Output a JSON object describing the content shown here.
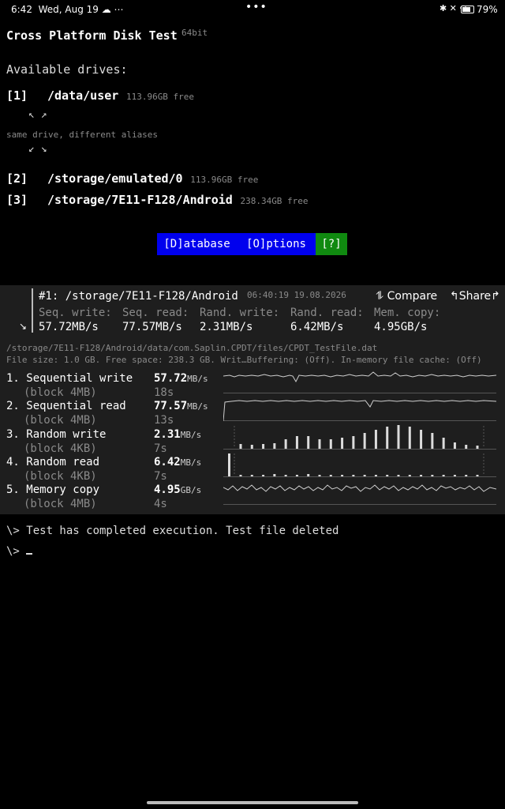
{
  "status_bar": {
    "time": "6:42",
    "date": "Wed, Aug 19",
    "left_icons": "☁ ⋯",
    "center_dots": "•••",
    "right_icons": "✱ ✕ ◠",
    "battery_percent": "79%",
    "battery_level": 0.79
  },
  "header": {
    "title": "Cross Platform Disk Test",
    "bits": "64bit"
  },
  "drives_heading": "Available drives:",
  "drives": [
    {
      "index": "[1]",
      "path": "/data/user",
      "free": "113.96GB free"
    },
    {
      "index": "[2]",
      "path": "/storage/emulated/0",
      "free": "113.96GB free"
    },
    {
      "index": "[3]",
      "path": "/storage/7E11-F128/Android",
      "free": "238.34GB free"
    }
  ],
  "alias_arrows_top": "↖ ↗",
  "alias_note": "same drive, different aliases",
  "alias_arrows_bottom": "↙ ↘",
  "buttons": {
    "database": "[D]atabase",
    "options": "[O]ptions",
    "help": "[?]"
  },
  "result_card": {
    "title": "#1: /storage/7E11-F128/Android",
    "timestamp": "06:40:19 19.08.2026",
    "compare": "⥮ Compare",
    "share": "↰Share↱",
    "collapse_icon": "↘",
    "labels": [
      "Seq. write:",
      "Seq. read:",
      "Rand. write:",
      "Rand. read:",
      "Mem. copy:"
    ],
    "values": [
      "57.72MB/s",
      "77.57MB/s",
      "2.31MB/s",
      "6.42MB/s",
      "4.95GB/s"
    ]
  },
  "file_path": "/storage/7E11-F128/Android/data/com.Saplin.CPDT/files/CPDT_TestFile.dat",
  "file_info": "File size: 1.0 GB. Free space: 238.3 GB. Writ…Buffering: (Off). In-memory file cache: (Off)",
  "tests": [
    {
      "name": "1. Sequential write",
      "block": "(block 4MB)",
      "value": "57.72",
      "unit": "MB/s",
      "time": "18s"
    },
    {
      "name": "2. Sequential read",
      "block": "(block 4MB)",
      "value": "77.57",
      "unit": "MB/s",
      "time": "13s"
    },
    {
      "name": "3. Random write",
      "block": "(block 4KB)",
      "value": "2.31",
      "unit": "MB/s",
      "time": "7s"
    },
    {
      "name": "4. Random read",
      "block": "(block 4KB)",
      "value": "6.42",
      "unit": "MB/s",
      "time": "7s"
    },
    {
      "name": "5. Memory copy",
      "block": "(block 4MB)",
      "value": "4.95",
      "unit": "GB/s",
      "time": "4s"
    }
  ],
  "console": {
    "line1": "\\> Test has completed execution. Test file deleted",
    "prompt": "\\>"
  }
}
